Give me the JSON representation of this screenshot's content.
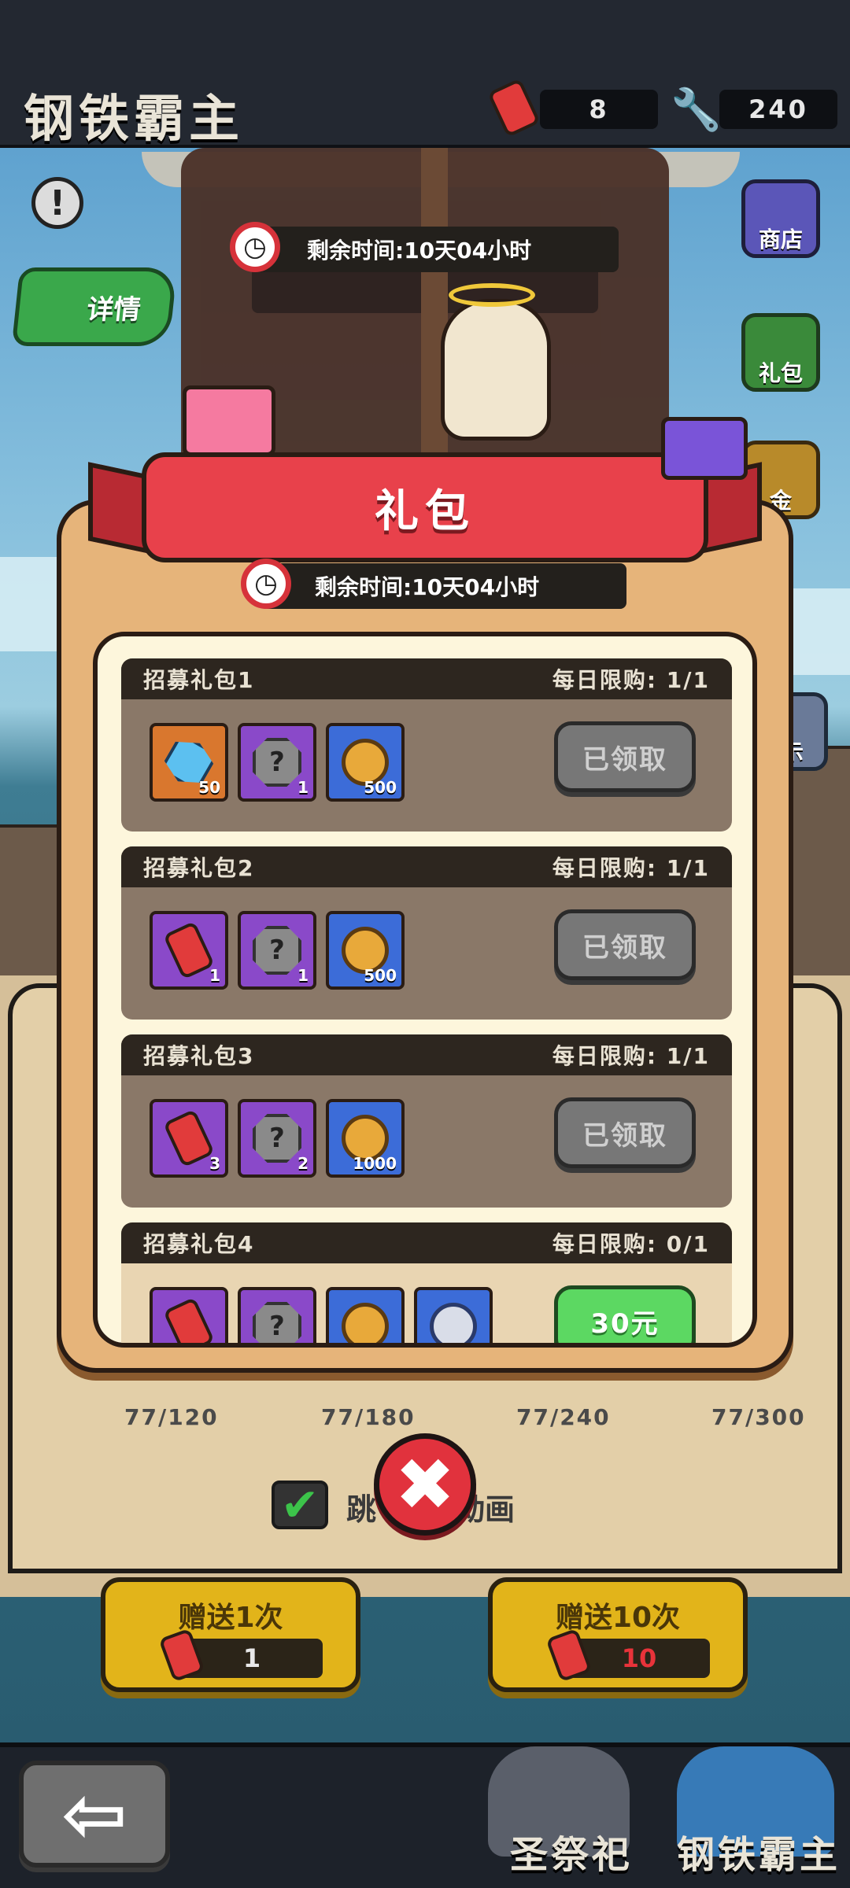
{
  "header": {
    "title": "钢铁霸主",
    "cans": "8",
    "wrenches": "240"
  },
  "side_menu": [
    {
      "label": "商店",
      "icon": "shop-icon"
    },
    {
      "label": "礼包",
      "icon": "gift-icon"
    },
    {
      "label": "金",
      "icon": "safe-icon"
    },
    {
      "label": "示",
      "icon": "film-icon"
    }
  ],
  "detail_button": "详情",
  "event_timer": "剩余时间:10天04小时",
  "modal": {
    "title": "礼包",
    "timer": "剩余时间:10天04小时",
    "packs": [
      {
        "name": "招募礼包1",
        "limit": "每日限购: 1/1",
        "button": "已领取",
        "claimed": true,
        "items": [
          {
            "type": "gem",
            "qty": "50",
            "color": "orange"
          },
          {
            "type": "stone",
            "qty": "1",
            "color": "purple"
          },
          {
            "type": "coin",
            "qty": "500",
            "color": "blue"
          }
        ]
      },
      {
        "name": "招募礼包2",
        "limit": "每日限购: 1/1",
        "button": "已领取",
        "claimed": true,
        "items": [
          {
            "type": "can",
            "qty": "1",
            "color": "purple"
          },
          {
            "type": "stone",
            "qty": "1",
            "color": "purple"
          },
          {
            "type": "coin",
            "qty": "500",
            "color": "blue"
          }
        ]
      },
      {
        "name": "招募礼包3",
        "limit": "每日限购: 1/1",
        "button": "已领取",
        "claimed": true,
        "items": [
          {
            "type": "can",
            "qty": "3",
            "color": "purple"
          },
          {
            "type": "stone",
            "qty": "2",
            "color": "purple"
          },
          {
            "type": "coin",
            "qty": "1000",
            "color": "blue"
          }
        ]
      },
      {
        "name": "招募礼包4",
        "limit": "每日限购: 0/1",
        "button": "30元",
        "claimed": false,
        "items": [
          {
            "type": "can",
            "qty": "",
            "color": "purple"
          },
          {
            "type": "stone",
            "qty": "",
            "color": "purple"
          },
          {
            "type": "coin",
            "qty": "",
            "color": "blue"
          },
          {
            "type": "film",
            "qty": "",
            "color": "blue"
          }
        ]
      }
    ]
  },
  "progress": [
    "77/120",
    "77/180",
    "77/240",
    "77/300"
  ],
  "skip_label_left": "跳",
  "skip_label_right": "动画",
  "gift_buttons": [
    {
      "title": "赠送1次",
      "cost": "1",
      "cost_color": "#e8e8e8"
    },
    {
      "title": "赠送10次",
      "cost": "10",
      "cost_color": "#e8333a"
    }
  ],
  "bottom_tabs": [
    "圣祭祀",
    "钢铁霸主"
  ]
}
